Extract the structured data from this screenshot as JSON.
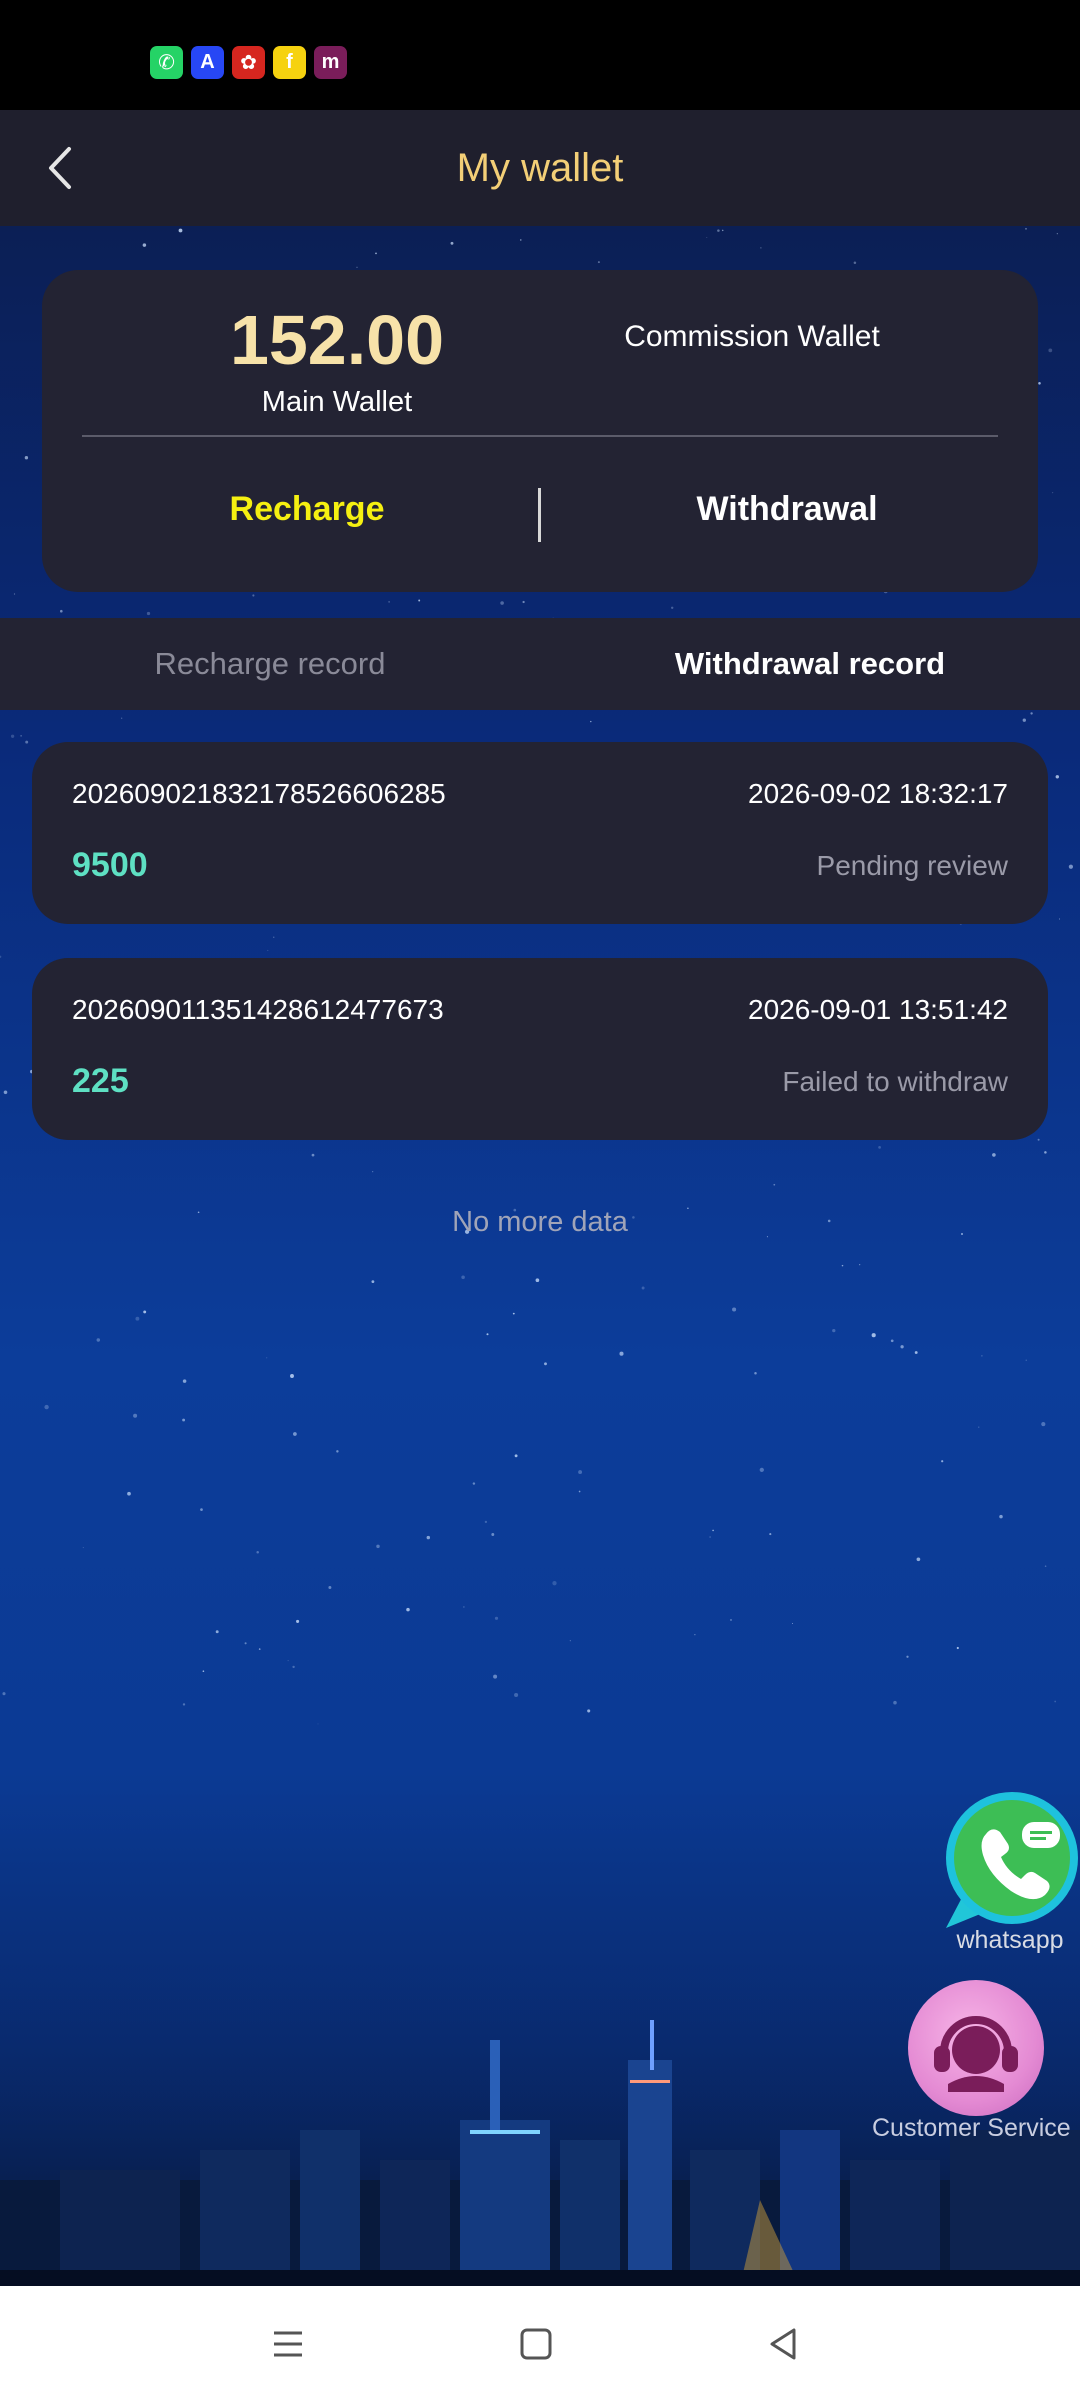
{
  "status_bar": {
    "app_icons": [
      {
        "name": "whatsapp-app-icon",
        "color": "#25d366",
        "glyph": "✆"
      },
      {
        "name": "delta-app-icon",
        "color": "#2747f5",
        "glyph": "A"
      },
      {
        "name": "red-app-icon",
        "color": "#d6261f",
        "glyph": "✿"
      },
      {
        "name": "flipkart-app-icon",
        "color": "#f6d20f",
        "glyph": "f"
      },
      {
        "name": "meesho-app-icon",
        "color": "#7a1d5a",
        "glyph": "m"
      }
    ]
  },
  "header": {
    "title": "My wallet",
    "back_icon": "chevron-left-icon"
  },
  "wallet": {
    "main_amount": "152.00",
    "main_label": "Main Wallet",
    "commission_label": "Commission Wallet",
    "recharge_label": "Recharge",
    "withdrawal_label": "Withdrawal"
  },
  "record_tabs": {
    "recharge": "Recharge record",
    "withdrawal": "Withdrawal record",
    "active": "withdrawal"
  },
  "records": [
    {
      "id": "20260902183217852660628​5",
      "time": "2026-09-02 18:32:17",
      "amount": "9500",
      "status": "Pending review"
    },
    {
      "id": "202609011351428612477673",
      "time": "2026-09-01 13:51:42",
      "amount": "225",
      "status": "Failed to withdraw"
    }
  ],
  "list_footer": "No more data",
  "floating": {
    "whatsapp_label": "whatsapp",
    "customer_service_label": "Customer Service"
  },
  "colors": {
    "title": "#f3cf77",
    "recharge": "#f5f011",
    "amount": "#5ee0c3",
    "card": "#232333"
  }
}
